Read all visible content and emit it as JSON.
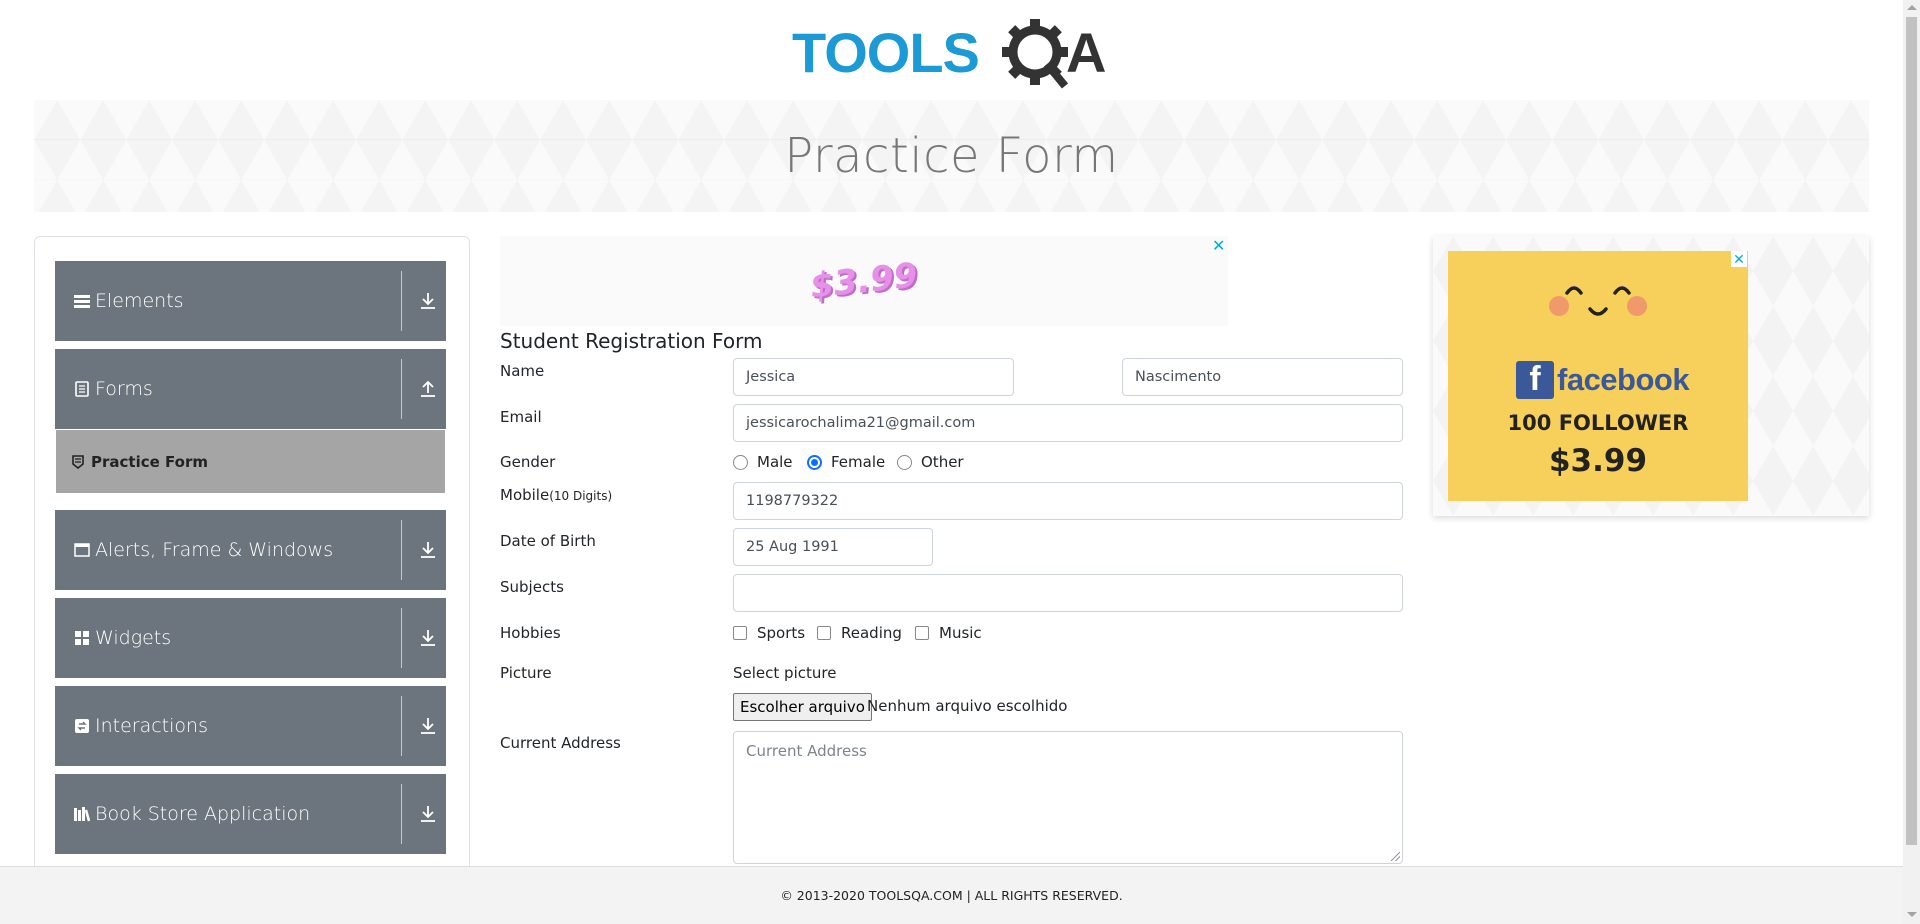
{
  "header": {
    "logo_text_left": "TOOLS",
    "logo_text_right": "A",
    "banner_title": "Practice Form"
  },
  "sidebar": {
    "groups": [
      {
        "label": "Elements",
        "icon": "hamburger-icon",
        "arrow": "download-arrow-icon"
      },
      {
        "label": "Forms",
        "icon": "document-icon",
        "arrow": "upload-arrow-icon"
      },
      {
        "label": "Alerts, Frame & Windows",
        "icon": "window-icon",
        "arrow": "download-arrow-icon"
      },
      {
        "label": "Widgets",
        "icon": "grid-icon",
        "arrow": "download-arrow-icon"
      },
      {
        "label": "Interactions",
        "icon": "interaction-icon",
        "arrow": "download-arrow-icon"
      },
      {
        "label": "Book Store Application",
        "icon": "books-icon",
        "arrow": "download-arrow-icon"
      }
    ],
    "active_subitem": {
      "label": "Practice Form",
      "icon": "form-icon"
    }
  },
  "ads": {
    "top_price": "$3.99",
    "top_close": "✕",
    "right_close": "✕",
    "right_brand": "facebook",
    "right_fb_letter": "f",
    "right_followers": "100 FOLLOWER",
    "right_price": "$3.99",
    "right_bg_color": "#f7cf5b"
  },
  "form": {
    "title": "Student Registration Form",
    "name_label": "Name",
    "first_name": "Jessica",
    "last_name": "Nascimento",
    "email_label": "Email",
    "email": "jessicarochalima21@gmail.com",
    "gender_label": "Gender",
    "gender_options": [
      "Male",
      "Female",
      "Other"
    ],
    "gender_selected": "Female",
    "mobile_label": "Mobile",
    "mobile_hint": "(10 Digits)",
    "mobile": "1198779322",
    "dob_label": "Date of Birth",
    "dob": "25 Aug 1991",
    "subjects_label": "Subjects",
    "subjects": "",
    "hobbies_label": "Hobbies",
    "hobbies": [
      "Sports",
      "Reading",
      "Music"
    ],
    "picture_label": "Picture",
    "picture_select": "Select picture",
    "file_button": "Escolher arquivo",
    "file_status": "Nenhum arquivo escolhido",
    "address_label": "Current Address",
    "address_placeholder": "Current Address",
    "accent_color": "#0d6efd"
  },
  "footer": {
    "text": "© 2013-2020 TOOLSQA.COM | ALL RIGHTS RESERVED."
  }
}
